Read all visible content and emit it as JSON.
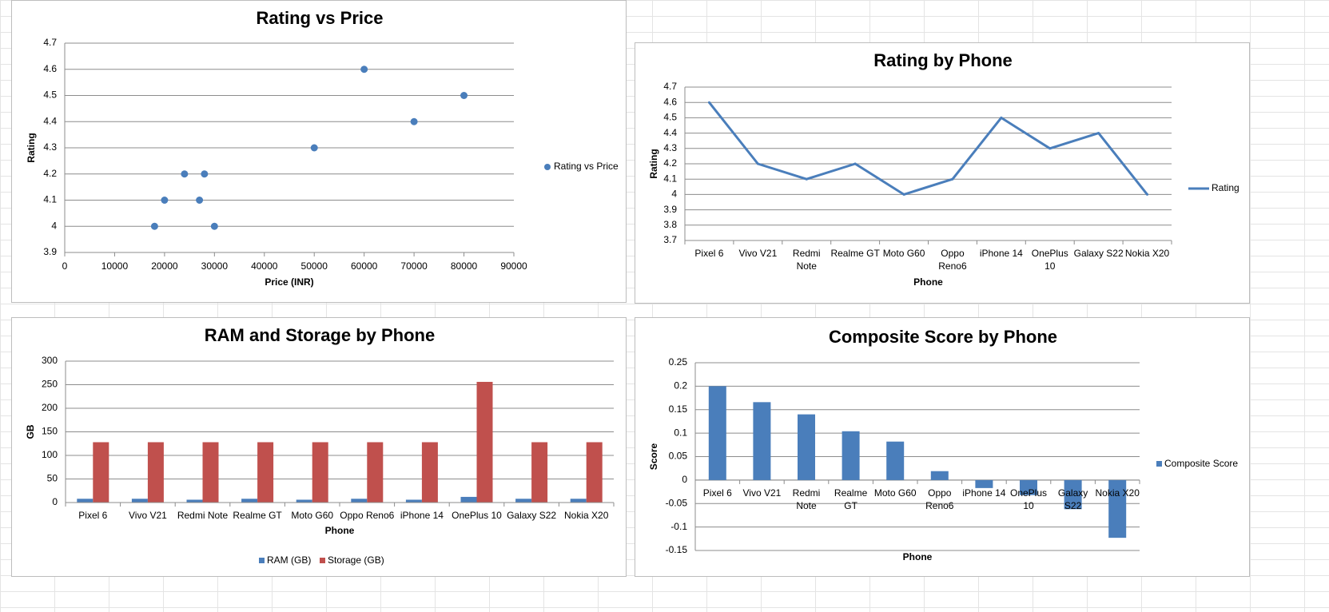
{
  "colors": {
    "blue": "#4a7ebb",
    "red": "#c0504d",
    "grid": "#8c8c8c",
    "axis": "#8c8c8c",
    "text": "#000000"
  },
  "chart_data": [
    {
      "id": "rating-vs-price",
      "type": "scatter",
      "title": "Rating vs Price",
      "xlabel": "Price (INR)",
      "ylabel": "Rating",
      "xlim": [
        0,
        90000
      ],
      "ylim": [
        3.9,
        4.7
      ],
      "xticks": [
        "0",
        "10000",
        "20000",
        "30000",
        "40000",
        "50000",
        "60000",
        "70000",
        "80000",
        "90000"
      ],
      "yticks": [
        "3.9",
        "4",
        "4.1",
        "4.2",
        "4.3",
        "4.4",
        "4.5",
        "4.6",
        "4.7"
      ],
      "grid": true,
      "legend_position": "right",
      "series": [
        {
          "name": "Rating vs Price",
          "points": [
            {
              "x": 60000,
              "y": 4.6
            },
            {
              "x": 20000,
              "y": 4.1
            },
            {
              "x": 30000,
              "y": 4.0
            },
            {
              "x": 28000,
              "y": 4.2
            },
            {
              "x": 18000,
              "y": 4.0
            },
            {
              "x": 27000,
              "y": 4.1
            },
            {
              "x": 80000,
              "y": 4.5
            },
            {
              "x": 50000,
              "y": 4.3
            },
            {
              "x": 70000,
              "y": 4.4
            },
            {
              "x": 24000,
              "y": 4.2
            }
          ]
        }
      ]
    },
    {
      "id": "rating-by-phone",
      "type": "line",
      "title": "Rating by Phone",
      "xlabel": "Phone",
      "ylabel": "Rating",
      "ylim": [
        3.7,
        4.7
      ],
      "yticks": [
        "3.7",
        "3.8",
        "3.9",
        "4",
        "4.1",
        "4.2",
        "4.3",
        "4.4",
        "4.5",
        "4.6",
        "4.7"
      ],
      "categories": [
        [
          "Pixel 6"
        ],
        [
          "Vivo V21"
        ],
        [
          "Redmi",
          "Note"
        ],
        [
          "Realme GT"
        ],
        [
          "Moto G60"
        ],
        [
          "Oppo",
          "Reno6"
        ],
        [
          "iPhone 14"
        ],
        [
          "OnePlus",
          "10"
        ],
        [
          "Galaxy S22"
        ],
        [
          "Nokia X20"
        ]
      ],
      "grid": true,
      "legend_position": "right",
      "series": [
        {
          "name": "Rating",
          "values": [
            4.6,
            4.2,
            4.1,
            4.2,
            4.0,
            4.1,
            4.5,
            4.3,
            4.4,
            4.0
          ]
        }
      ]
    },
    {
      "id": "ram-storage-by-phone",
      "type": "bar",
      "title": "RAM and Storage by Phone",
      "xlabel": "Phone",
      "ylabel": "GB",
      "ylim": [
        0,
        300
      ],
      "yticks": [
        "0",
        "50",
        "100",
        "150",
        "200",
        "250",
        "300"
      ],
      "categories": [
        [
          "Pixel 6"
        ],
        [
          "Vivo V21"
        ],
        [
          "Redmi Note"
        ],
        [
          "Realme GT"
        ],
        [
          "Moto G60"
        ],
        [
          "Oppo Reno6"
        ],
        [
          "iPhone 14"
        ],
        [
          "OnePlus 10"
        ],
        [
          "Galaxy S22"
        ],
        [
          "Nokia X20"
        ]
      ],
      "grid": true,
      "legend_position": "bottom",
      "series": [
        {
          "name": "RAM (GB)",
          "values": [
            8,
            8,
            6,
            8,
            6,
            8,
            6,
            12,
            8,
            8
          ]
        },
        {
          "name": "Storage (GB)",
          "values": [
            128,
            128,
            128,
            128,
            128,
            128,
            128,
            256,
            128,
            128
          ]
        }
      ]
    },
    {
      "id": "composite-score-by-phone",
      "type": "bar",
      "title": "Composite Score by Phone",
      "xlabel": "Phone",
      "ylabel": "Score",
      "ylim": [
        -0.15,
        0.25
      ],
      "yticks": [
        "-0.15",
        "-0.1",
        "-0.05",
        "0",
        "0.05",
        "0.1",
        "0.15",
        "0.2",
        "0.25"
      ],
      "categories": [
        [
          "Pixel 6"
        ],
        [
          "Vivo V21"
        ],
        [
          "Redmi",
          "Note"
        ],
        [
          "Realme",
          "GT"
        ],
        [
          "Moto G60"
        ],
        [
          "Oppo",
          "Reno6"
        ],
        [
          "iPhone 14"
        ],
        [
          "OnePlus",
          "10"
        ],
        [
          "Galaxy",
          "S22"
        ],
        [
          "Nokia X20"
        ]
      ],
      "grid": true,
      "legend_position": "right",
      "series": [
        {
          "name": "Composite Score",
          "values": [
            0.2,
            0.166,
            0.14,
            0.104,
            0.082,
            0.019,
            -0.017,
            -0.032,
            -0.062,
            -0.123
          ]
        }
      ]
    }
  ]
}
